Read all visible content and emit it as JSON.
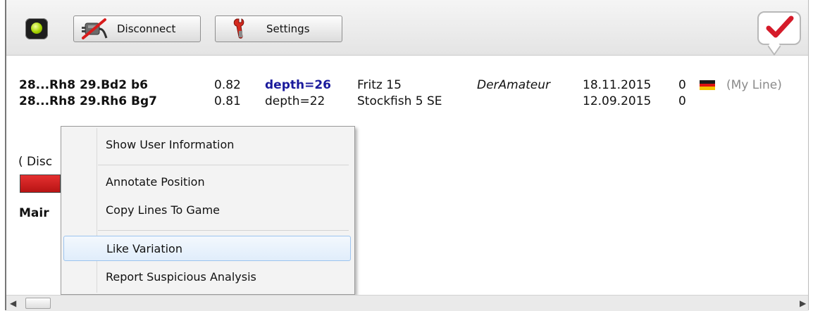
{
  "toolbar": {
    "disconnect_label": "Disconnect",
    "settings_label": "Settings"
  },
  "lines": [
    {
      "moves": "28...Rh8 29.Bd2 b6",
      "score": "0.82",
      "depth": "depth=26",
      "engine": "Fritz 15",
      "user": "DerAmateur",
      "date": "18.11.2015",
      "likes": "0",
      "note": "(My Line)"
    },
    {
      "moves": "28...Rh8 29.Rh6 Bg7",
      "score": "0.81",
      "depth": "depth=22",
      "engine": "Stockfish 5 SE",
      "user": "",
      "date": "12.09.2015",
      "likes": "0",
      "note": ""
    }
  ],
  "partial_text": {
    "disc": "( Disc",
    "main": "Mair"
  },
  "flag_colors": [
    "#1a1a1a",
    "#dd1111",
    "#f2c200"
  ],
  "context_menu": {
    "items": [
      "Show User Information",
      "Annotate Position",
      "Copy Lines To Game",
      "Like Variation",
      "Report Suspicious Analysis"
    ]
  },
  "icons": {
    "status": "green-led-icon",
    "disconnect": "plug-disconnect-icon",
    "settings": "wrench-icon",
    "like": "checkmark-speech-bubble-icon"
  }
}
